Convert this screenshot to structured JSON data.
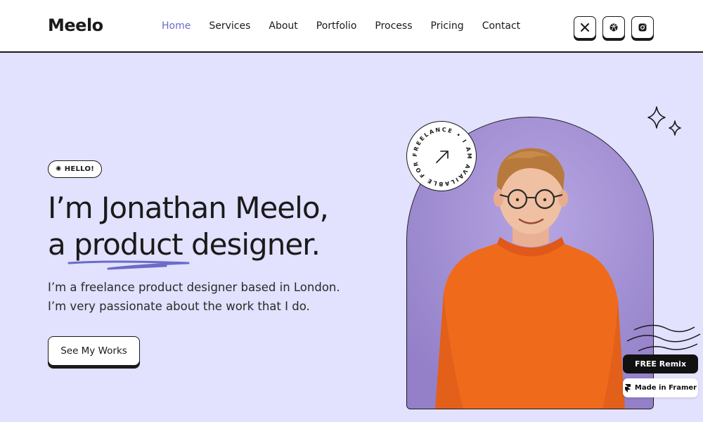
{
  "brand": {
    "logo": "Meelo"
  },
  "nav": {
    "items": [
      {
        "label": "Home",
        "active": true
      },
      {
        "label": "Services"
      },
      {
        "label": "About"
      },
      {
        "label": "Portfolio"
      },
      {
        "label": "Process"
      },
      {
        "label": "Pricing"
      },
      {
        "label": "Contact"
      }
    ]
  },
  "socials": [
    "x-icon",
    "dribbble-icon",
    "instagram-icon"
  ],
  "hero": {
    "badge": "HELLO!",
    "title_line1": "I’m Jonathan Meelo,",
    "title_line2_a": "a ",
    "title_line2_b": "product",
    "title_line2_c": " designer.",
    "subtitle_line1": "I’m a freelance product designer based in London.",
    "subtitle_line2": "I’m very passionate about the work that I do.",
    "cta": "See My Works"
  },
  "stamp": {
    "text": "FREELANCE • I AM AVAILABLE FOR "
  },
  "framer": {
    "remix": "FREE Remix",
    "made": "Made in Framer"
  },
  "colors": {
    "background": "#e2e1fe",
    "accent": "#6b6bc8",
    "arch": "#a28fd4",
    "sweater": "#f06a1c"
  }
}
